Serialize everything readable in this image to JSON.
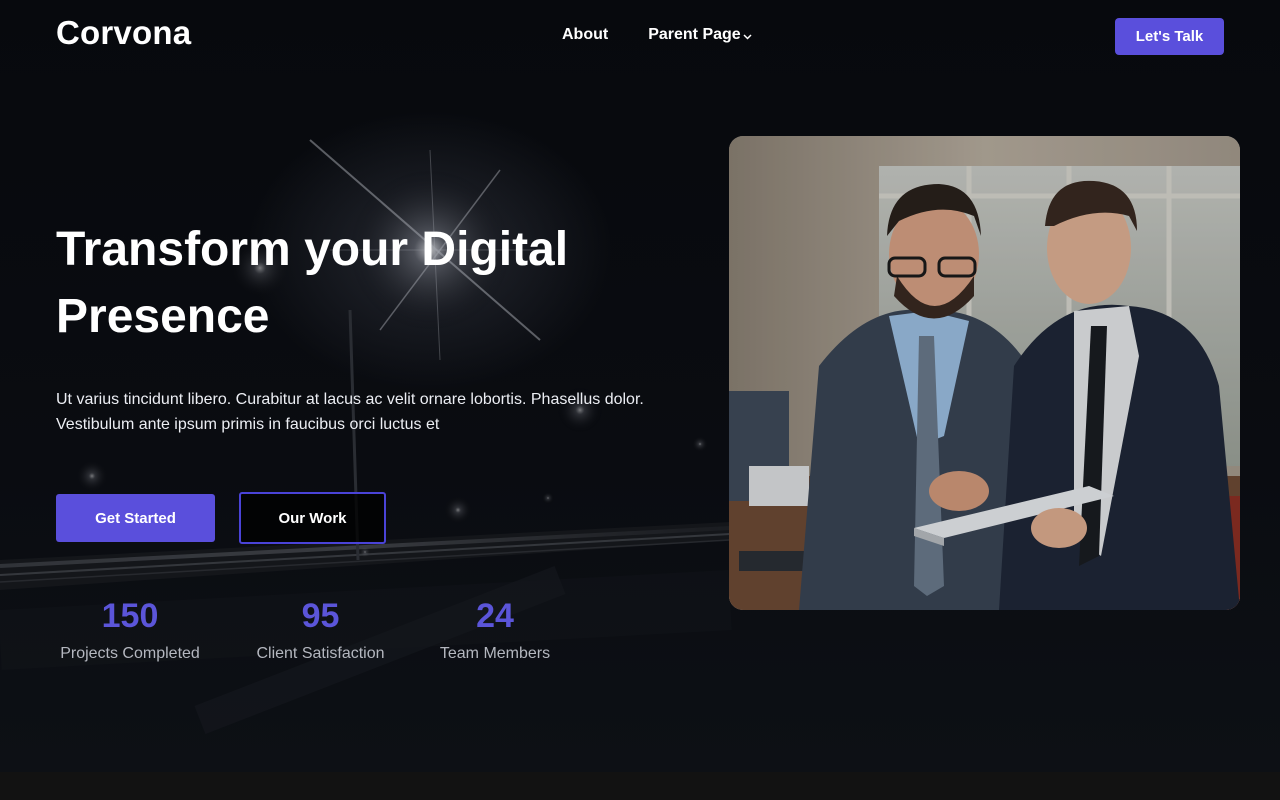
{
  "brand": {
    "name": "Corvona",
    "accent_color": "#5a4fdc"
  },
  "nav": {
    "items": [
      {
        "label": "About"
      },
      {
        "label": "Parent Page",
        "icon": "chevron-down-icon"
      }
    ],
    "cta_label": "Let's Talk"
  },
  "hero": {
    "title": "Transform your Digital Presence",
    "description": "Ut varius tincidunt libero. Curabitur at lacus ac velit ornare lobortis. Phasellus dolor. Vestibulum ante ipsum primis in faucibus orci luctus et",
    "primary_button": "Get Started",
    "secondary_button": "Our Work"
  },
  "stats": [
    {
      "value": "150",
      "label": "Projects Completed"
    },
    {
      "value": "95",
      "label": "Client Satisfaction"
    },
    {
      "value": "24",
      "label": "Team Members"
    }
  ],
  "colors": {
    "background": "#0b0d12",
    "stat_value": "#5b55d9",
    "footer": "#121212"
  }
}
